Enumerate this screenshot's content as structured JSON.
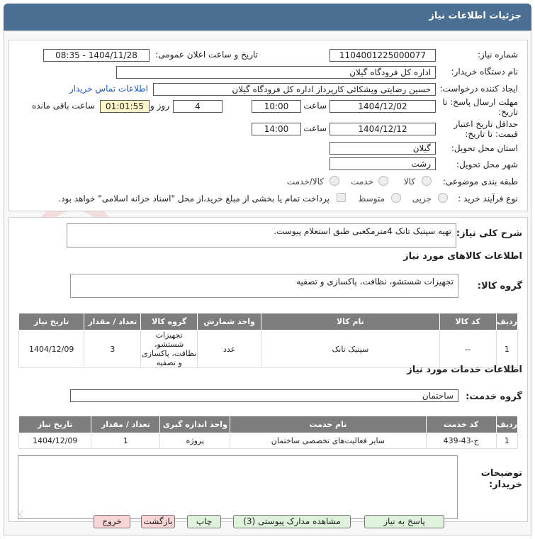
{
  "title": "جزئیات اطلاعات نیاز",
  "labels": {
    "need_number": "شماره نیاز:",
    "announce_datetime": "تاریخ و ساعت اعلان عمومی:",
    "buyer_org": "نام دستگاه خریدار:",
    "requester": "ایجاد کننده درخواست:",
    "buyer_contact": "اطلاعات تماس خریدار",
    "reply_deadline": "مهلت ارسال پاسخ: تا تاریخ:",
    "time_word": "ساعت",
    "day_word": "روز و",
    "remaining": "ساعت باقی مانده",
    "price_validity": "حداقل تاریخ اعتبار قیمت: تا تاریخ:",
    "province": "استان محل تحویل:",
    "city": "شهر محل تحویل:",
    "category": "طبقه بندی موضوعی:",
    "process": "نوع فرآیند خرید :"
  },
  "values": {
    "need_number": "1104001225000077",
    "announce_datetime": "1404/11/28 - 08:35",
    "buyer_org": "اداره کل فرودگاه گیلان",
    "requester": "حسین رضایتی ویشکائی کارپرداز اداره کل فرودگاه گیلان",
    "reply_date": "1404/12/02",
    "reply_time": "10:00",
    "days": "4",
    "remaining_time": "01:01:55",
    "validity_date": "1404/12/12",
    "validity_time": "14:00",
    "province": "گیلان",
    "city": "رشت"
  },
  "category_options": [
    "کالا",
    "خدمت",
    "کالا/خدمت"
  ],
  "process_options": [
    "جزیی",
    "متوسط"
  ],
  "treasury_note": "پرداخت تمام یا بخشی از مبلغ خرید،از محل \"اسناد خزانه اسلامی\" خواهد بود.",
  "description": {
    "label": "شرح کلی نیاز:",
    "text": "تهیه سپتیک تانک 4مترمکعبی طبق استعلام پیوست."
  },
  "goods": {
    "section_title": "اطلاعات کالاهای مورد نیاز",
    "group_label": "گروه کالا:",
    "group_value": "تجهیزات شستشو، نظافت، پاکسازی و تصفیه",
    "headers": [
      "ردیف",
      "کد کالا",
      "نام کالا",
      "واحد شمارش",
      "گروه کالا",
      "تعداد / مقدار",
      "تاریخ نیاز"
    ],
    "rows": [
      [
        "1",
        "--",
        "سپتیک تانک",
        "عدد",
        "تجهیزات شستشو، نظافت، پاکسازی و تصفیه",
        "3",
        "1404/12/09"
      ]
    ]
  },
  "services": {
    "section_title": "اطلاعات خدمات مورد نیاز",
    "group_label": "گروه خدمت:",
    "group_value": "ساختمان",
    "headers": [
      "ردیف",
      "کد خدمت",
      "نام خدمت",
      "واحد اندازه گیری",
      "تعداد / مقدار",
      "تاریخ نیاز"
    ],
    "rows": [
      [
        "1",
        "ج-43-439",
        "سایر فعالیت‌های تخصصی ساختمان",
        "پروژه",
        "1",
        "1404/12/09"
      ]
    ]
  },
  "buyer_notes_label": "توضیحات خریدار:",
  "buttons": {
    "reply": "پاسخ به نیاز",
    "attachments": "مشاهده مدارک پیوستی (3)",
    "print": "چاپ",
    "back": "بازگشت",
    "exit": "خروج"
  },
  "colors": {
    "header_bg": "#4a6f93",
    "table_header": "#7d7d7d",
    "link": "#1e57c8",
    "remaining_bg": "#fff7c8"
  }
}
